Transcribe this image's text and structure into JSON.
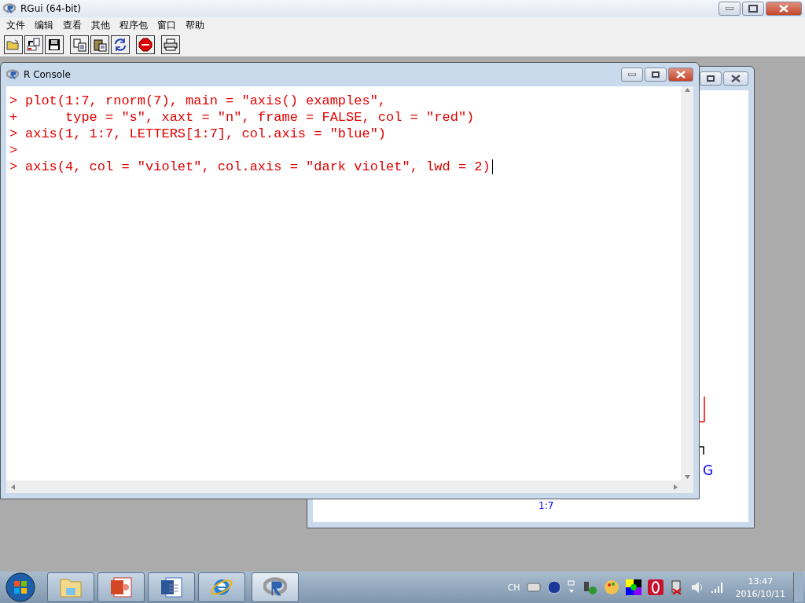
{
  "window": {
    "title": "RGui (64-bit)"
  },
  "menu": [
    "文件",
    "编辑",
    "查看",
    "其他",
    "程序包",
    "窗口",
    "帮助"
  ],
  "toolbar": [
    {
      "kind": "open"
    },
    {
      "kind": "load"
    },
    {
      "kind": "save"
    },
    {
      "kind": "copy"
    },
    {
      "kind": "paste"
    },
    {
      "kind": "refresh"
    },
    {
      "kind": "stop"
    },
    {
      "kind": "print"
    }
  ],
  "graphics_window": {
    "labels": [
      {
        "kind": "axis-letter",
        "text": "G"
      },
      {
        "kind": "axis-title",
        "text": "1:7"
      }
    ]
  },
  "console": {
    "title": "R Console",
    "lines": [
      {
        "prompt": ">",
        "code": "plot(1:7, rnorm(7), main = \"axis() examples\",",
        "cursor": false
      },
      {
        "prompt": "+",
        "code": "     type = \"s\", xaxt = \"n\", frame = FALSE, col = \"red\")",
        "cursor": false
      },
      {
        "prompt": ">",
        "code": "axis(1, 1:7, LETTERS[1:7], col.axis = \"blue\")",
        "cursor": false
      },
      {
        "prompt": ">",
        "cursor": false
      },
      {
        "prompt": ">",
        "code": "axis(4, col = \"violet\", col.axis = \"dark violet\", lwd = 2)",
        "cursor": true
      }
    ]
  },
  "taskbar": {
    "apps": [
      {
        "kind": "folder",
        "selected": false
      },
      {
        "kind": "slides",
        "selected": false
      },
      {
        "kind": "document",
        "selected": false
      },
      {
        "kind": "browser",
        "selected": false
      },
      {
        "kind": "r",
        "selected": true
      }
    ],
    "tray": {
      "language": "CH",
      "time": "13:47",
      "date": "2016/10/11"
    }
  }
}
